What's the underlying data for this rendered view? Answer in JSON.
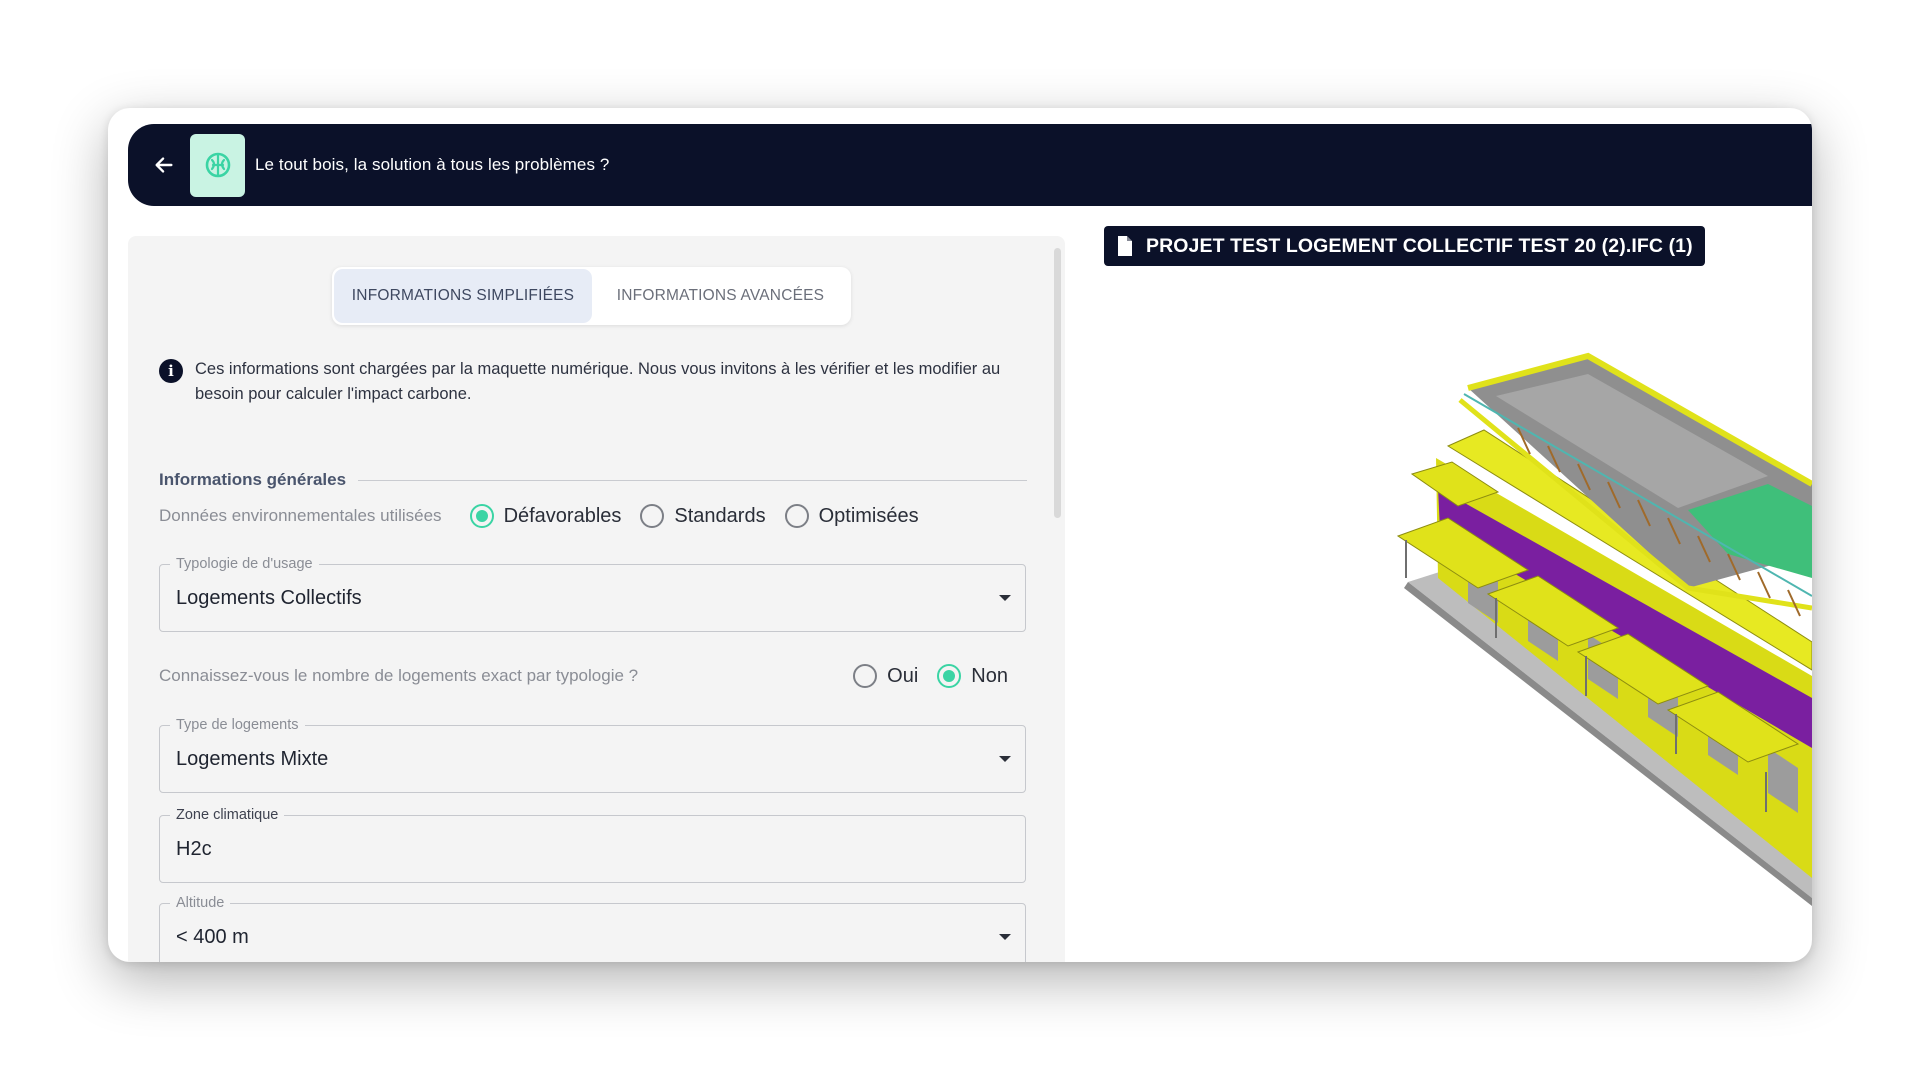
{
  "header": {
    "back_icon": "arrow-left-icon",
    "logo_icon": "leaf-brain-icon",
    "title": "Le tout bois, la solution à tous les problèmes ?"
  },
  "tabs": [
    {
      "label": "Informations simplifiées",
      "active": true
    },
    {
      "label": "Informations avancées",
      "active": false
    }
  ],
  "info_notice": {
    "icon": "info-icon",
    "text": "Ces informations sont chargées par la maquette numérique. Nous vous invitons à les vérifier et les modifier au besoin pour calculer l'impact carbone."
  },
  "general_section": {
    "title": "Informations générales"
  },
  "environmental_data": {
    "label": "Données environnementales utilisées",
    "options": [
      "Défavorables",
      "Standards",
      "Optimisées"
    ],
    "selected": "Défavorables"
  },
  "usage_typology": {
    "label": "Typologie de d'usage",
    "value": "Logements Collectifs"
  },
  "exact_count_question": {
    "label": "Connaissez-vous le nombre de logements exact par typologie ?",
    "options": [
      "Oui",
      "Non"
    ],
    "selected": "Non"
  },
  "housing_type": {
    "label": "Type de logements",
    "value": "Logements Mixte"
  },
  "climate_zone": {
    "label": "Zone climatique",
    "value": "H2c"
  },
  "altitude": {
    "label": "Altitude",
    "value": "< 400 m"
  },
  "file_badge": {
    "icon": "document-icon",
    "label": "PROJET TEST LOGEMENT COLLECTIF TEST 20 (2).IFC (1)"
  },
  "colors": {
    "navy": "#0b1129",
    "accent": "#3ad4a4",
    "tab_active_bg": "#e7ecf6",
    "panel_bg": "#f4f4f4",
    "model_yellow": "#e0e21a",
    "model_purple": "#7a1fa0",
    "model_green": "#3fbf7a",
    "model_roof": "#9a9a9a"
  }
}
